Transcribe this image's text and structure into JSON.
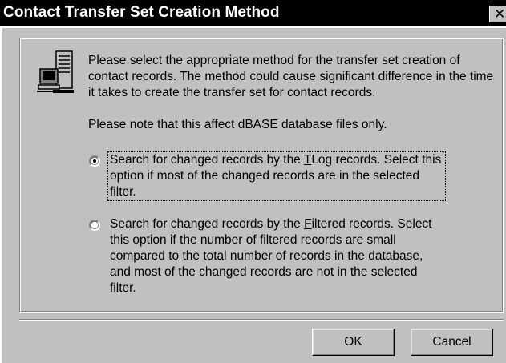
{
  "window": {
    "title": "Contact Transfer Set Creation Method",
    "close_glyph": "✕"
  },
  "content": {
    "intro": "Please select the appropriate method for the transfer set creation of contact records.  The method could cause significant difference in the time it takes to create the transfer set for contact records.",
    "note": "Please note that this affect dBASE database files only.",
    "icon": "computer-network-icon"
  },
  "options": [
    {
      "selected": true,
      "text_before": "Search for changed records by the ",
      "mnemonic": "T",
      "text_after": "Log records.  Select this option if most of the changed records are in the selected filter."
    },
    {
      "selected": false,
      "text_before": "Search for changed records by the ",
      "mnemonic": "F",
      "text_after": "iltered records.  Select this option if the number of filtered records are small compared to the total number of records in the database, and most of the changed records are not in the selected filter."
    }
  ],
  "buttons": {
    "ok_label": "OK",
    "cancel_label": "Cancel"
  },
  "colors": {
    "face": "#c0c0c0",
    "titlebar": "#000000",
    "title_text": "#ffffff"
  }
}
